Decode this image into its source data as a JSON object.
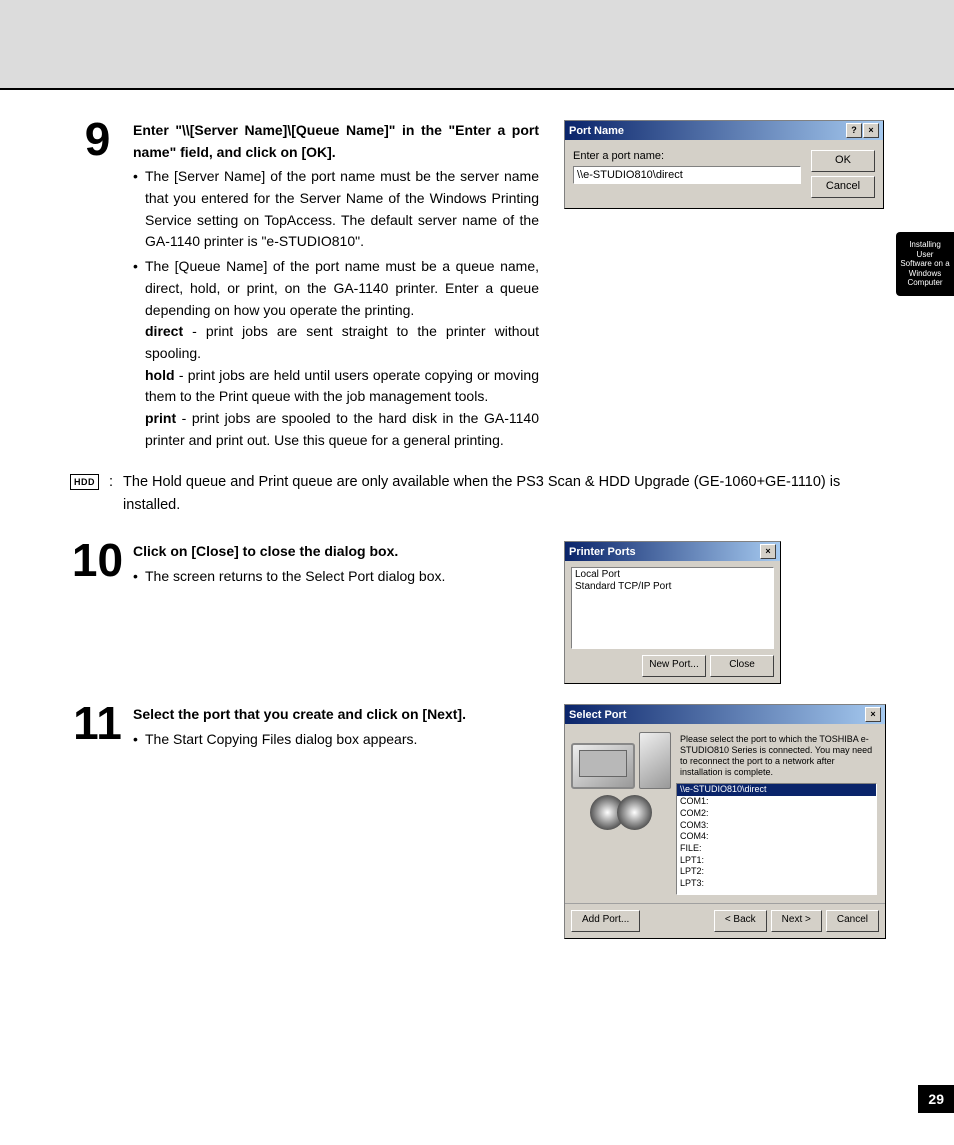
{
  "pageNumber": "29",
  "sideTab": {
    "line1": "Installing User",
    "line2": "Software on a",
    "line3": "Windows Computer"
  },
  "step9": {
    "num": "9",
    "title": "Enter \"\\\\[Server Name]\\[Queue Name]\" in the \"Enter a port name\" field, and click on [OK].",
    "b1": "The [Server Name] of the port name must be the server name that you entered for the Server Name of the Windows Printing Service setting on TopAccess. The default server name of the GA-1140 printer is \"e-STUDIO810\".",
    "b2": "The [Queue Name] of the port name must be a queue name, direct, hold, or print, on the GA-1140 printer. Enter a queue depending on how you operate the printing.",
    "direct_label": "direct",
    "direct_text": " - print jobs are sent straight to the printer without spooling.",
    "hold_label": "hold",
    "hold_text": " - print jobs are held until users operate copying or moving them to the Print queue with the job management tools.",
    "print_label": "print",
    "print_text": " - print jobs are spooled to the hard disk in the GA-1140 printer and print out.  Use this queue for a general printing."
  },
  "portNameDialog": {
    "title": "Port Name",
    "label": "Enter a port name:",
    "value": "\\\\e-STUDIO810\\direct",
    "ok": "OK",
    "cancel": "Cancel"
  },
  "note": {
    "icon": "HDD",
    "colon": ":",
    "text": "The Hold queue and Print queue are only available when the PS3 Scan & HDD Upgrade (GE-1060+GE-1110) is installed."
  },
  "step10": {
    "num": "10",
    "title": "Click on [Close] to close the dialog box.",
    "b1": "The screen returns to the Select Port dialog box."
  },
  "printerPortsDialog": {
    "title": "Printer Ports",
    "item1": "Local Port",
    "item2": "Standard TCP/IP Port",
    "newPort": "New Port...",
    "close": "Close"
  },
  "step11": {
    "num": "11",
    "title": "Select the port that you create and click on [Next].",
    "b1": "The Start Copying Files dialog box appears."
  },
  "selectPortDialog": {
    "title": "Select Port",
    "instruction": "Please select the port to which the TOSHIBA e-STUDIO810 Series is connected. You may need to reconnect the port to a network after installation is complete.",
    "items": [
      "\\\\e-STUDIO810\\direct",
      "COM1:",
      "COM2:",
      "COM3:",
      "COM4:",
      "FILE:",
      "LPT1:",
      "LPT2:",
      "LPT3:"
    ],
    "addPort": "Add Port...",
    "back": "< Back",
    "next": "Next >",
    "cancel": "Cancel"
  }
}
